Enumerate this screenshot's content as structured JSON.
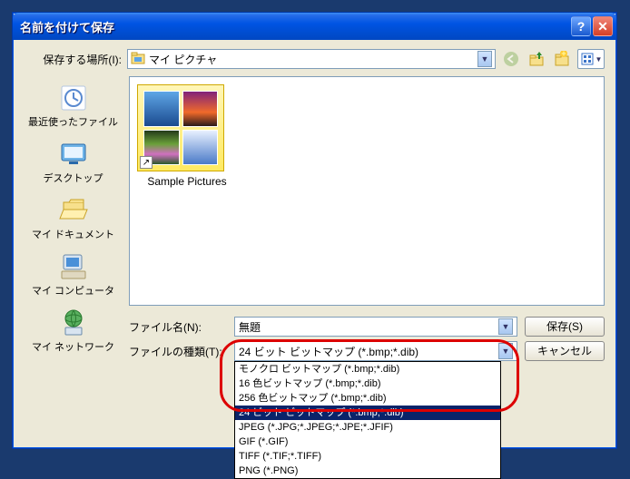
{
  "dialog": {
    "title": "名前を付けて保存"
  },
  "lookin": {
    "label": "保存する場所(I):",
    "value": "マイ ピクチャ"
  },
  "sidebar": {
    "items": [
      {
        "label": "最近使ったファイル"
      },
      {
        "label": "デスクトップ"
      },
      {
        "label": "マイ ドキュメント"
      },
      {
        "label": "マイ コンピュータ"
      },
      {
        "label": "マイ ネットワーク"
      }
    ]
  },
  "filepane": {
    "item_label": "Sample Pictures"
  },
  "filename": {
    "label": "ファイル名(N):",
    "value": "無題"
  },
  "filetype": {
    "label": "ファイルの種類(T):",
    "value": "24 ビット ビットマップ (*.bmp;*.dib)"
  },
  "buttons": {
    "save": "保存(S)",
    "cancel": "キャンセル"
  },
  "dropdown": {
    "options": [
      "モノクロ ビットマップ (*.bmp;*.dib)",
      "16 色ビットマップ (*.bmp;*.dib)",
      "256 色ビットマップ (*.bmp;*.dib)",
      "24 ビット ビットマップ (*.bmp;*.dib)",
      "JPEG (*.JPG;*.JPEG;*.JPE;*.JFIF)",
      "GIF (*.GIF)",
      "TIFF (*.TIF;*.TIFF)",
      "PNG (*.PNG)"
    ],
    "selected_index": 3
  }
}
